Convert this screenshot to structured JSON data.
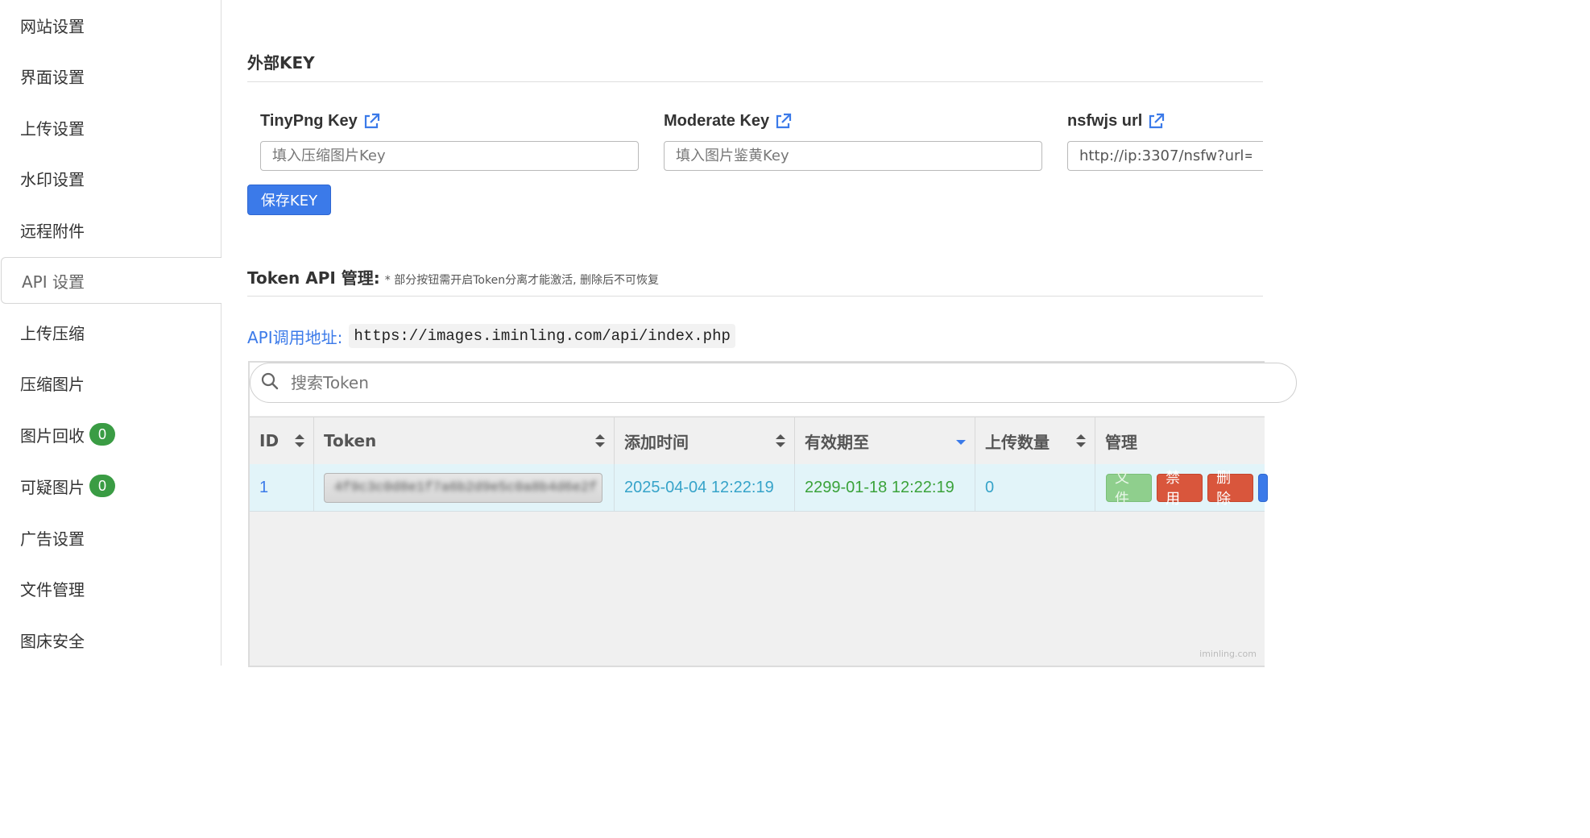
{
  "sidebar": {
    "items": [
      {
        "label": "网站设置"
      },
      {
        "label": "界面设置"
      },
      {
        "label": "上传设置"
      },
      {
        "label": "水印设置"
      },
      {
        "label": "远程附件"
      },
      {
        "label": "API 设置",
        "active": true
      },
      {
        "label": "上传压缩"
      },
      {
        "label": "压缩图片"
      },
      {
        "label": "图片回收",
        "badge": "0"
      },
      {
        "label": "可疑图片",
        "badge": "0"
      },
      {
        "label": "广告设置"
      },
      {
        "label": "文件管理"
      },
      {
        "label": "图床安全"
      }
    ]
  },
  "external_key": {
    "title": "外部KEY",
    "fields": [
      {
        "label": "TinyPng Key",
        "placeholder": "填入压缩图片Key",
        "value": ""
      },
      {
        "label": "Moderate Key",
        "placeholder": "填入图片鉴黄Key",
        "value": ""
      },
      {
        "label": "nsfwjs url",
        "placeholder": "",
        "value": "http://ip:3307/nsfw?url="
      }
    ],
    "save_label": "保存KEY"
  },
  "token_api": {
    "title": "Token API 管理:",
    "note": "* 部分按钮需开启Token分离才能激活, 删除后不可恢复",
    "api_label": "API调用地址:",
    "api_url": "https://images.iminling.com/api/index.php",
    "search_placeholder": "搜索Token",
    "columns": [
      "ID",
      "Token",
      "添加时间",
      "有效期至",
      "上传数量",
      "管理"
    ],
    "rows": [
      {
        "id": "1",
        "token": "4f9c3c0d8e1f7a6b2d9e5c0a8b4d6e2f",
        "added": "2025-04-04 12:22:19",
        "expires": "2299-01-18 12:22:19",
        "uploads": "0",
        "actions": [
          "文件",
          "禁用",
          "删除"
        ]
      }
    ]
  },
  "colors": {
    "accent": "#3b7ae9",
    "badge": "#3a9c44",
    "danger": "#d9563c",
    "row_highlight": "#e2f4f9",
    "date_added": "#36a3c9",
    "date_expires": "#3aa23a"
  },
  "watermark": "iminling.com"
}
